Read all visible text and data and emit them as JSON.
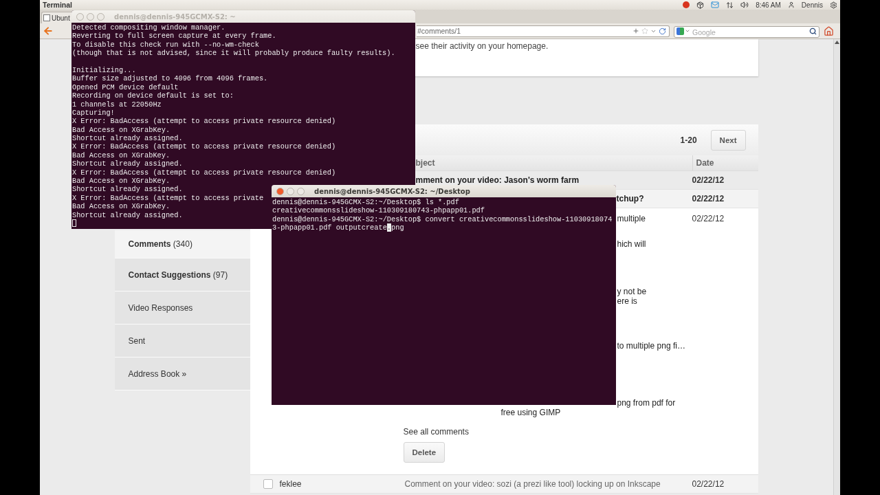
{
  "panel": {
    "app_title": "Terminal",
    "clock": "8:46 AM",
    "user": "Dennis"
  },
  "browser": {
    "tabs": [
      {
        "label": "Ubunt",
        "selected": true
      }
    ],
    "address": "#comments/1",
    "search": {
      "placeholder": "Google"
    },
    "page": {
      "notice": "see their activity on your homepage.",
      "pager": {
        "range": "1-20",
        "next": "Next"
      },
      "columns": [
        "bject",
        "Date"
      ],
      "sidebar": [
        {
          "label": "**Comments** (340)",
          "selected": true
        },
        {
          "label": "**Contact Suggestions** (97)",
          "selected": false
        },
        {
          "label": "Video Responses",
          "selected": false
        },
        {
          "label": "Sent",
          "selected": false
        },
        {
          "label": "Address Book »",
          "selected": false
        }
      ],
      "messages": [
        {
          "kind": "summary",
          "subject": "mment on your video: Jason's worm farm",
          "date": "02/22/12",
          "unread": true
        },
        {
          "kind": "summary",
          "subject": "tchup?",
          "date": "02/22/12",
          "unread": true
        },
        {
          "kind": "expanded",
          "date": "02/22/12",
          "unread": false,
          "snippets": [
            {
              "tail": [
                "multiple"
              ]
            },
            {
              "tail": [
                "hich will"
              ]
            },
            {
              "tail": [
                "y not be",
                "ere is"
              ]
            },
            {
              "tail": [
                "to multiple png fi…"
              ]
            },
            {
              "tail": [
                "png from pdf for"
              ],
              "lines": [
                "free using GIMP"
              ]
            }
          ],
          "see_all": "See all comments",
          "delete": "Delete"
        },
        {
          "kind": "summary",
          "checked": false,
          "sender": "feklee",
          "subject": "Comment on your video: sozi (a prezi like tool) locking up on Inkscape",
          "date": "02/22/12",
          "unread": false
        }
      ]
    }
  },
  "terminals": [
    {
      "title": "dennis@dennis-945GCMX-S2: ~",
      "active": false,
      "cursor": true,
      "blocks": [
        [
          "Detected compositing window manager.",
          "Reverting to full screen capture at every frame.",
          "To disable this check run with --no-wm-check",
          "(though that is not advised, since it will probably produce faulty results)."
        ],
        [
          "Initializing...",
          "Buffer size adjusted to 4096 from 4096 frames.",
          "Opened PCM device default",
          "Recording on device default is set to:",
          "1 channels at 22050Hz",
          "Capturing!",
          "X Error: BadAccess (attempt to access private resource denied)",
          "Bad Access on XGrabKey.",
          "Shortcut already assigned.",
          "X Error: BadAccess (attempt to access private resource denied)",
          "Bad Access on XGrabKey.",
          "Shortcut already assigned.",
          "X Error: BadAccess (attempt to access private resource denied)",
          "Bad Access on XGrabKey.",
          "Shortcut already assigned.",
          "X Error: BadAccess (attempt to access private",
          "Bad Access on XGrabKey.",
          "Shortcut already assigned."
        ]
      ]
    },
    {
      "title": "dennis@dennis-945GCMX-S2: ~/Desktop",
      "active": true,
      "cursor": true,
      "blocks": [
        [
          "dennis@dennis-945GCMX-S2:~/Desktop$ ls *.pdf",
          "creativecommonsslideshow-110309180743-phpapp01.pdf",
          "dennis@dennis-945GCMX-S2:~/Desktop$ convert creativecommonsslideshow-11030918074"
        ]
      ],
      "input": {
        "text": "3-phpapp01.pdf outputcreate",
        "cursor_char": ".",
        "rest": "png"
      }
    }
  ]
}
